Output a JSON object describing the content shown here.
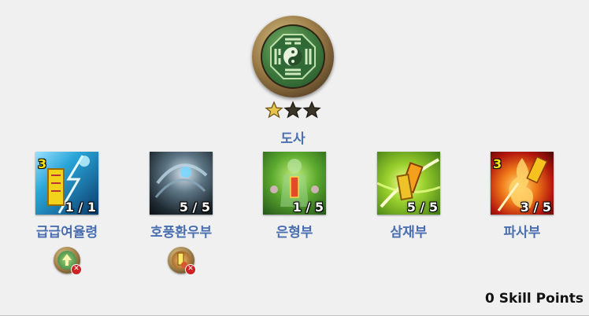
{
  "class": {
    "name": "도사",
    "stars_filled": 1,
    "stars_total": 3,
    "emblem_icon": "yin-yang-bagua-icon"
  },
  "skills": [
    {
      "name": "급급여율령",
      "rank": "1 / 1",
      "required_level": "3",
      "icon": "talisman-lightning-icon",
      "prerequisite_icon": "buff-arrow-icon"
    },
    {
      "name": "호풍환우부",
      "rank": "5 / 5",
      "required_level": "",
      "icon": "whirlwind-icon",
      "prerequisite_icon": "fire-talisman-icon"
    },
    {
      "name": "은형부",
      "rank": "1 / 5",
      "required_level": "",
      "icon": "stealth-spirit-icon"
    },
    {
      "name": "삼재부",
      "rank": "5 / 5",
      "required_level": "",
      "icon": "triple-talisman-icon"
    },
    {
      "name": "파사부",
      "rank": "3 / 5",
      "required_level": "3",
      "icon": "flame-strike-icon"
    }
  ],
  "skill_points": "0 Skill Points"
}
